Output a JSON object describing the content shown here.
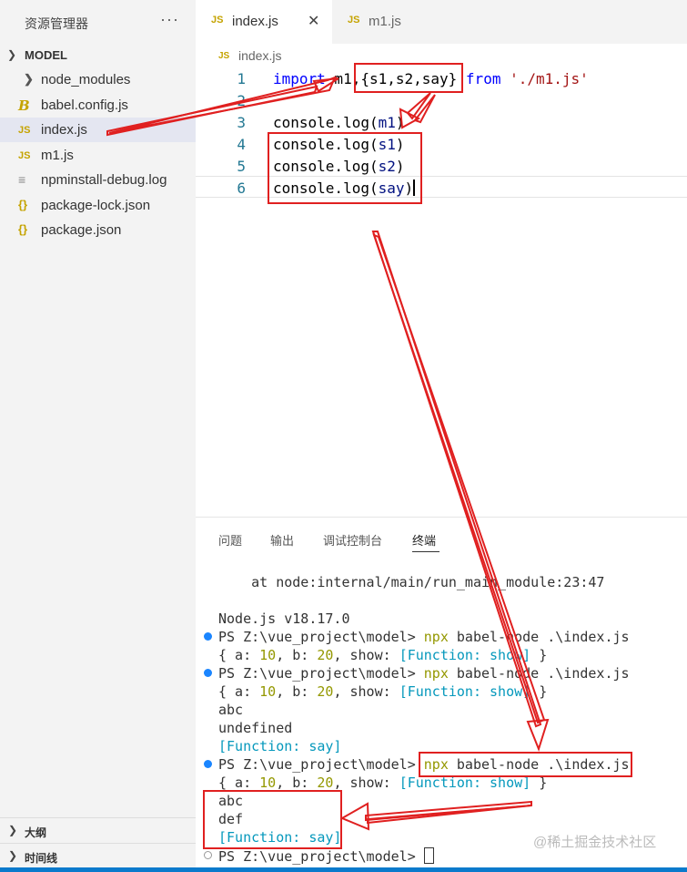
{
  "sidebar": {
    "title": "资源管理器",
    "more": "···",
    "folder": "MODEL",
    "items": [
      {
        "name": "node_modules",
        "icon": "chevron-right-icon",
        "glyph": "❯"
      },
      {
        "name": "babel.config.js",
        "icon": "babel-icon",
        "glyph": "B"
      },
      {
        "name": "index.js",
        "icon": "js-file-icon",
        "glyph": "JS"
      },
      {
        "name": "m1.js",
        "icon": "js-file-icon",
        "glyph": "JS"
      },
      {
        "name": "npminstall-debug.log",
        "icon": "log-file-icon",
        "glyph": "≡"
      },
      {
        "name": "package-lock.json",
        "icon": "json-file-icon",
        "glyph": "{}"
      },
      {
        "name": "package.json",
        "icon": "json-file-icon",
        "glyph": "{}"
      }
    ],
    "outline": "大纲",
    "timeline": "时间线"
  },
  "tabs": [
    {
      "label": "index.js",
      "icon": "JS",
      "close": "✕"
    },
    {
      "label": "m1.js",
      "icon": "JS"
    }
  ],
  "breadcrumb": {
    "icon": "JS",
    "label": "index.js"
  },
  "editor": {
    "line_numbers": [
      "1",
      "2",
      "3",
      "4",
      "5",
      "6"
    ],
    "line1": {
      "kw": "import",
      "rest": " m1,{s1,s2,say} ",
      "from": "from",
      "str": "'./m1.js'"
    },
    "line3": {
      "fn": "console.log",
      "open": "(",
      "arg": "m1",
      "close": ")"
    },
    "line4": {
      "fn": "console.log",
      "open": "(",
      "arg": "s1",
      "close": ")"
    },
    "line5": {
      "fn": "console.log",
      "open": "(",
      "arg": "s2",
      "close": ")"
    },
    "line6": {
      "fn": "console.log",
      "open": "(",
      "arg": "say",
      "close": ")"
    }
  },
  "panel": {
    "tabs": [
      "问题",
      "输出",
      "调试控制台",
      "终端"
    ],
    "active_tab": "终端"
  },
  "terminal": {
    "stack_line": "    at node:internal/main/run_main_module:23:47",
    "node_version": "Node.js v18.17.0",
    "prompt": "PS Z:\\vue_project\\model> ",
    "cmd_npx": "npx",
    "cmd_rest": " babel-node .\\index.js",
    "obj_open": "{ a: ",
    "obj_a": "10",
    "obj_b_label": ", b: ",
    "obj_b": "20",
    "obj_show_label": ", show: ",
    "obj_show": "[Function: show]",
    "obj_close": " }",
    "out_abc": "abc",
    "out_undefined": "undefined",
    "out_fn_say": "[Function: say]",
    "out_def": "def"
  },
  "watermark": "@稀土掘金技术社区",
  "colors": {
    "annotation": "#e02020",
    "accent": "#0a7acc"
  }
}
